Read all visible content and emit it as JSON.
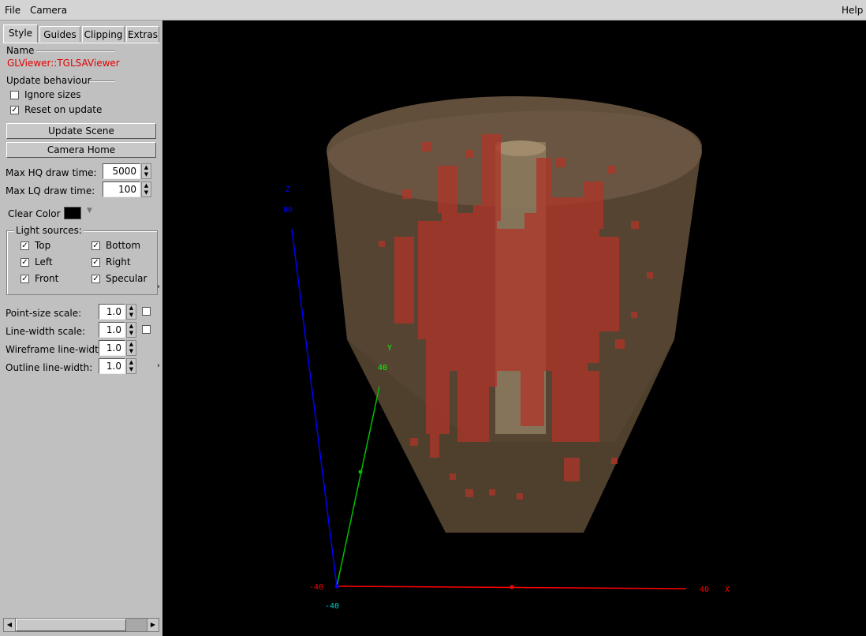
{
  "menubar": {
    "file": "File",
    "camera": "Camera",
    "help": "Help"
  },
  "tabs": [
    "Style",
    "Guides",
    "Clipping",
    "Extras"
  ],
  "style": {
    "name_label": "Name",
    "name_value": "GLViewer::TGLSAViewer",
    "update_label": "Update behaviour",
    "ignore_sizes": {
      "label": "Ignore sizes",
      "checked": false
    },
    "reset_on_update": {
      "label": "Reset on update",
      "checked": true
    },
    "update_scene": "Update Scene",
    "camera_home": "Camera Home",
    "max_hq": {
      "label": "Max HQ draw time:",
      "value": "5000"
    },
    "max_lq": {
      "label": "Max LQ draw time:",
      "value": "100"
    },
    "clear_color_label": "Clear Color",
    "clear_color": "#000000",
    "light_sources_label": "Light sources:",
    "lights": [
      {
        "label": "Top",
        "checked": true
      },
      {
        "label": "Bottom",
        "checked": true
      },
      {
        "label": "Left",
        "checked": true
      },
      {
        "label": "Right",
        "checked": true
      },
      {
        "label": "Front",
        "checked": true
      },
      {
        "label": "Specular",
        "checked": true
      }
    ],
    "point_size": {
      "label": "Point-size scale:",
      "value": "1.0"
    },
    "line_width": {
      "label": "Line-width scale:",
      "value": "1.0"
    },
    "wireframe": {
      "label": "Wireframe line-width:",
      "value": "1.0"
    },
    "outline": {
      "label": "Outline line-width:",
      "value": "1.0"
    }
  },
  "viewport": {
    "axis_z_label": "Z",
    "axis_z_max": "80",
    "axis_y_label": "Y",
    "axis_y_max": "40",
    "axis_x_label": "X",
    "axis_x_max": "40",
    "axis_x_min": "-40",
    "axis_y_min": "-40",
    "colors": {
      "x_axis": "#ff0000",
      "y_axis": "#00ff00",
      "z_axis": "#0000ff",
      "shell": "#5c4a36",
      "cells": "#b03428"
    }
  }
}
